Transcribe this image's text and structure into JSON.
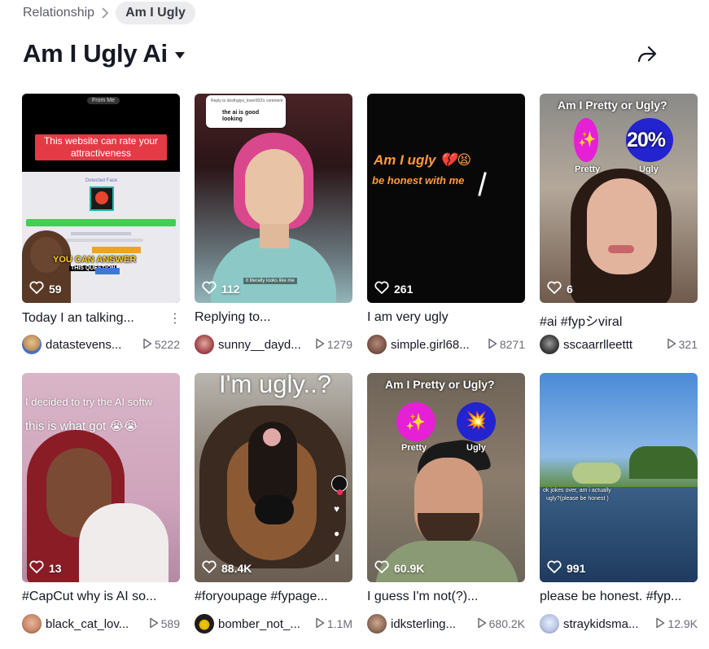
{
  "breadcrumb": {
    "parent": "Relationship",
    "current": "Am I Ugly"
  },
  "page": {
    "title": "Am I Ugly Ai"
  },
  "videos": [
    {
      "likes": "59",
      "caption": "Today I an talking...",
      "author": "datastevens...",
      "views": "5222",
      "overlay": {
        "top": "From Me",
        "red_banner": "This website can rate your attractiveness",
        "sub": "Detected Face",
        "bottom_a": "YOU CAN ANSWER",
        "bottom_b": "THIS QUESTION"
      },
      "avatar_color": "#c2a27a"
    },
    {
      "likes": "112",
      "caption": "Replying to...",
      "author": "sunny__dayd...",
      "views": "1279",
      "overlay": {
        "reply_head": "Reply to dosthgiyo_lover003's comment",
        "reply_body": "the ai is good looking",
        "sub": "it literally looks like me"
      },
      "avatar_color": "#a4474c"
    },
    {
      "likes": "261",
      "caption": "I am very ugly",
      "author": "simple.girl68...",
      "views": "8271",
      "overlay": {
        "line1": "Am I ugly 💔😫",
        "line2": "be honest with me"
      },
      "avatar_color": "#7a5547"
    },
    {
      "likes": "6",
      "caption": "#ai #fypシviral",
      "author": "sscaarrlleettt",
      "views": "321",
      "overlay": {
        "title": "Am I Pretty or Ugly?",
        "left_label": "Pretty",
        "right_label": "Ugly",
        "right_value": "20%"
      },
      "avatar_color": "#3a3a3a"
    },
    {
      "likes": "13",
      "caption": "#CapCut why is AI so...",
      "author": "black_cat_lov...",
      "views": "589",
      "overlay": {
        "line1": "I decided to try the AI softw",
        "line2": "this is what  got  😭😭"
      },
      "avatar_color": "#c88a6a"
    },
    {
      "likes": "88.4K",
      "caption": "#foryoupage #fypage...",
      "author": "bomber_not_...",
      "views": "1.1M",
      "overlay": {
        "line1": "I'm ugly..?"
      },
      "avatar_color": "#2d2b28"
    },
    {
      "likes": "60.9K",
      "caption": "I guess I'm not(?)...",
      "author": "idksterling...",
      "views": "680.2K",
      "overlay": {
        "title": "Am I Pretty or Ugly?",
        "left_label": "Pretty",
        "right_label": "Ugly"
      },
      "avatar_color": "#8b6a56"
    },
    {
      "likes": "991",
      "caption": "please be honest. #fyp...",
      "author": "straykidsma...",
      "views": "12.9K",
      "overlay": {
        "line1": "ok jokes over, am i actually",
        "line2": "ugly?(please be honest )"
      },
      "avatar_color": "#b9c6e4"
    }
  ],
  "colors": {
    "brand_pink": "#fe2c55",
    "muted": "#6b6c75"
  }
}
